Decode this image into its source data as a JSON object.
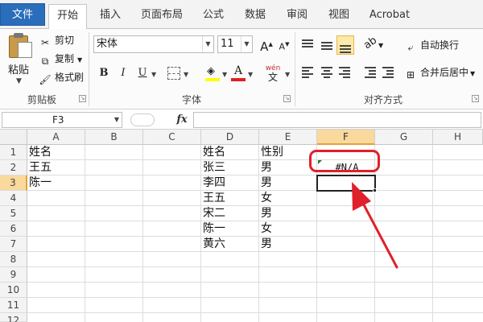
{
  "ribbon_tabs": [
    {
      "label": "文件"
    },
    {
      "label": "开始"
    },
    {
      "label": "插入"
    },
    {
      "label": "页面布局"
    },
    {
      "label": "公式"
    },
    {
      "label": "数据"
    },
    {
      "label": "审阅"
    },
    {
      "label": "视图"
    },
    {
      "label": "Acrobat"
    }
  ],
  "active_tab": "开始",
  "clipboard": {
    "paste_label": "粘贴",
    "cut_label": "剪切",
    "copy_label": "复制",
    "format_painter_label": "格式刷",
    "group_label": "剪贴板"
  },
  "font": {
    "name": "宋体",
    "size": "11",
    "grow_icon": "A",
    "shrink_icon": "A",
    "bold_icon": "B",
    "italic_icon": "I",
    "underline_icon": "U",
    "font_color_icon": "A",
    "fill_color": "#ffff00",
    "font_color": "#e02020",
    "phonetic_icon": "wén",
    "group_label": "字体"
  },
  "alignment": {
    "wrap_text_label": "自动换行",
    "merge_center_label": "合并后居中",
    "group_label": "对齐方式"
  },
  "formula_bar": {
    "name_box": "F3",
    "fx_label": "fx",
    "formula": ""
  },
  "columns": [
    "A",
    "B",
    "C",
    "D",
    "E",
    "F",
    "G",
    "H"
  ],
  "rows": [
    "1",
    "2",
    "3",
    "4",
    "5",
    "6",
    "7",
    "8",
    "9",
    "10",
    "11",
    "12"
  ],
  "cells": {
    "A1": "姓名",
    "A2": "王五",
    "A3": "陈一",
    "D1": "姓名",
    "D2": "张三",
    "D3": "李四",
    "D4": "王五",
    "D5": "宋二",
    "D6": "陈一",
    "D7": "黄六",
    "E1": "性别",
    "E2": "男",
    "E3": "男",
    "E4": "女",
    "E5": "男",
    "E6": "女",
    "E7": "男",
    "F2": "#N/A"
  },
  "selected_cell": "F3",
  "colors": {
    "accent": "#2a6ebb",
    "selection_header": "#f9d99c",
    "annotation": "#e0202a"
  }
}
